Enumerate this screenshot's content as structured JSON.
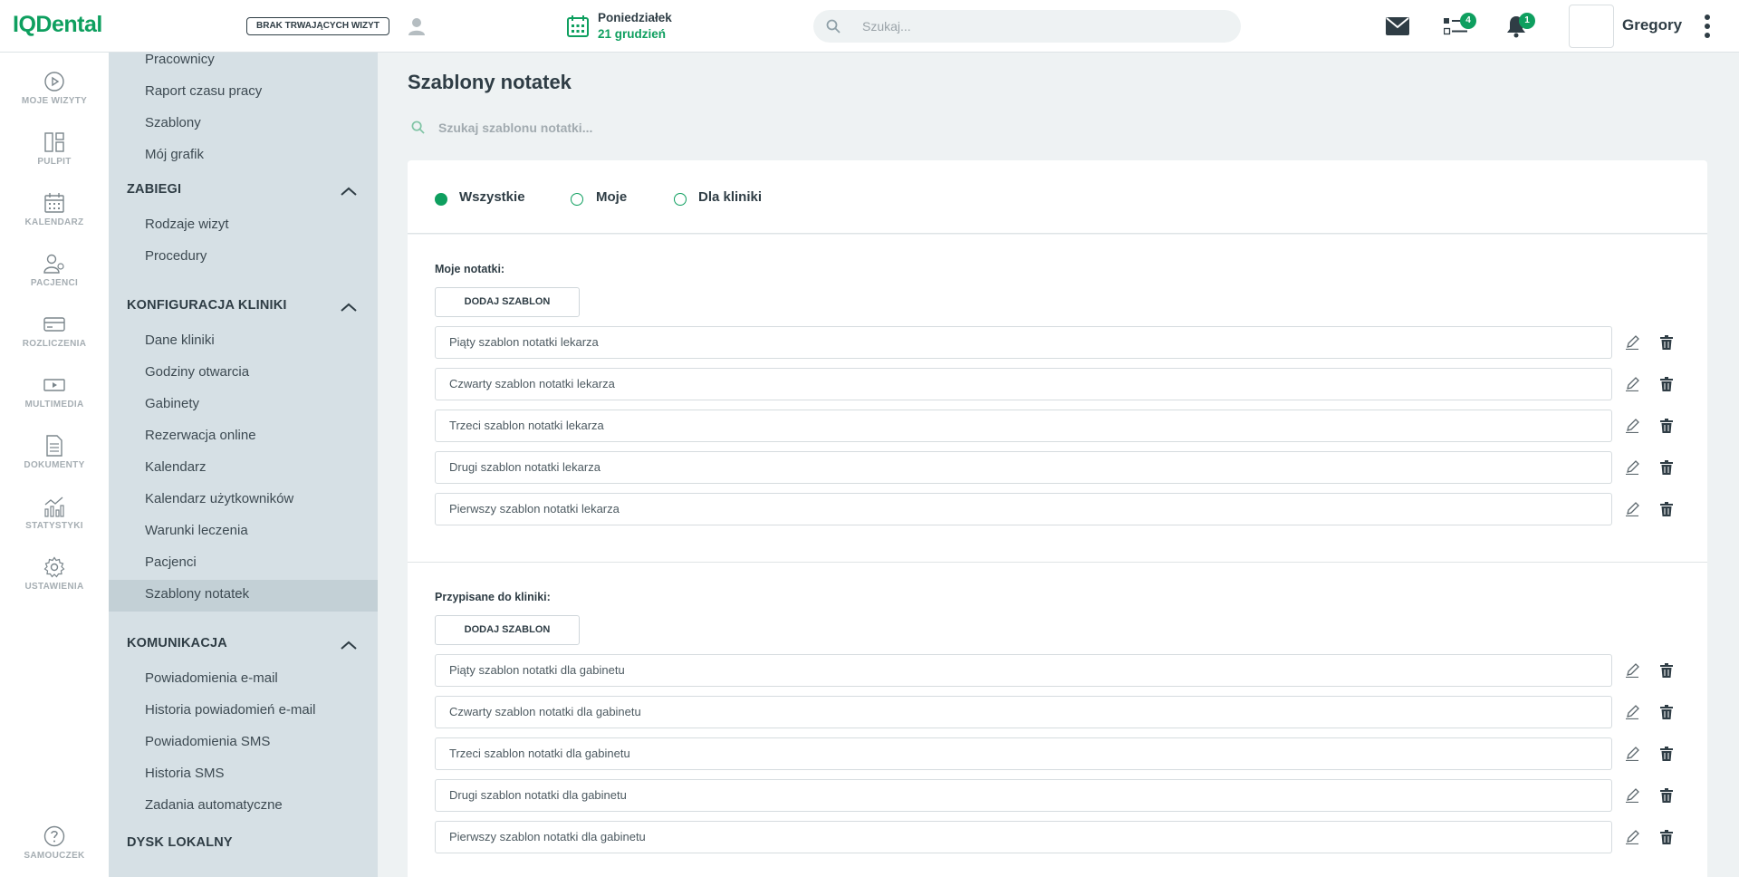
{
  "app": {
    "logo": "IQDental",
    "visit_badge": "BRAK TRWAJĄCYCH WIZYT",
    "date_day": "Poniedziałek",
    "date_date": "21 grudzień",
    "search_placeholder": "Szukaj...",
    "tasks_count": "4",
    "notifications_count": "1",
    "user_name": "Gregory",
    "accent_color": "#0e9f5f"
  },
  "icon_nav": [
    {
      "label": "MOJE WIZYTY",
      "icon": "play-circle-icon"
    },
    {
      "label": "PULPIT",
      "icon": "dashboard-icon"
    },
    {
      "label": "KALENDARZ",
      "icon": "calendar-icon"
    },
    {
      "label": "PACJENCI",
      "icon": "patients-icon"
    },
    {
      "label": "ROZLICZENIA",
      "icon": "card-icon"
    },
    {
      "label": "MULTIMEDIA",
      "icon": "media-icon"
    },
    {
      "label": "DOKUMENTY",
      "icon": "document-icon"
    },
    {
      "label": "STATYSTYKI",
      "icon": "stats-icon"
    },
    {
      "label": "USTAWIENIA",
      "icon": "gear-icon"
    },
    {
      "label": "SAMOUCZEK",
      "icon": "help-icon"
    }
  ],
  "sidebar": {
    "top_links": [
      "Pracownicy",
      "Raport czasu pracy",
      "Szablony",
      "Mój grafik"
    ],
    "sections": [
      {
        "title": "ZABIEGI",
        "items": [
          "Rodzaje wizyt",
          "Procedury"
        ]
      },
      {
        "title": "KONFIGURACJA KLINIKI",
        "items": [
          "Dane kliniki",
          "Godziny otwarcia",
          "Gabinety",
          "Rezerwacja online",
          "Kalendarz",
          "Kalendarz użytkowników",
          "Warunki leczenia",
          "Pacjenci",
          "Szablony notatek"
        ]
      },
      {
        "title": "KOMUNIKACJA",
        "items": [
          "Powiadomienia e-mail",
          "Historia powiadomień e-mail",
          "Powiadomienia SMS",
          "Historia SMS",
          "Zadania automatyczne"
        ]
      },
      {
        "title": "DYSK LOKALNY",
        "items": []
      }
    ],
    "active_item": "Szablony notatek"
  },
  "main": {
    "title": "Szablony notatek",
    "search_placeholder": "Szukaj szablonu notatki...",
    "filters": [
      {
        "label": "Wszystkie",
        "selected": true
      },
      {
        "label": "Moje",
        "selected": false
      },
      {
        "label": "Dla kliniki",
        "selected": false
      }
    ],
    "groups": [
      {
        "label": "Moje notatki:",
        "add_label": "DODAJ SZABLON",
        "templates": [
          "Piąty szablon notatki lekarza",
          "Czwarty szablon notatki lekarza",
          "Trzeci szablon notatki lekarza",
          "Drugi szablon notatki lekarza",
          "Pierwszy szablon notatki lekarza"
        ]
      },
      {
        "label": "Przypisane do kliniki:",
        "add_label": "DODAJ SZABLON",
        "templates": [
          "Piąty szablon notatki dla gabinetu",
          "Czwarty szablon notatki dla gabinetu",
          "Trzeci szablon notatki dla gabinetu",
          "Drugi szablon notatki dla gabinetu",
          "Pierwszy szablon notatki dla gabinetu"
        ]
      }
    ]
  }
}
